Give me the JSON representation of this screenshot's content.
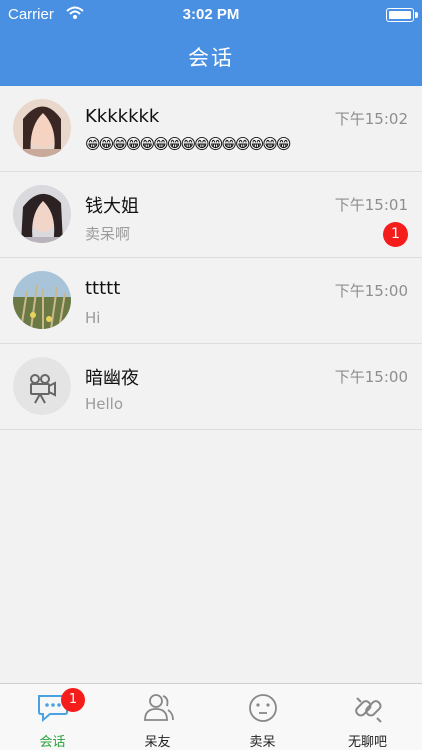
{
  "status_bar": {
    "carrier": "Carrier",
    "time": "3:02 PM"
  },
  "nav": {
    "title": "会话"
  },
  "conversations": [
    {
      "name": "Kkkkkkk",
      "time": "下午15:02",
      "preview": "😁😁😁😁😁😁😁😁😁😁😁😁😁😁😁",
      "unread": ""
    },
    {
      "name": "钱大姐",
      "time": "下午15:01",
      "preview": "卖呆啊",
      "unread": "1"
    },
    {
      "name": "ttttt",
      "time": "下午15:00",
      "preview": "Hi",
      "unread": ""
    },
    {
      "name": "暗幽夜",
      "time": "下午15:00",
      "preview": "Hello",
      "unread": ""
    }
  ],
  "tabbar": {
    "tabs": [
      {
        "label": "会话",
        "badge": "1",
        "icon": "chat-bubble-icon"
      },
      {
        "label": "呆友",
        "icon": "friends-icon"
      },
      {
        "label": "卖呆",
        "icon": "face-icon"
      },
      {
        "label": "无聊吧",
        "icon": "chain-link-icon"
      }
    ]
  },
  "colors": {
    "header": "#4a90e2",
    "active_tab": "#2aa33a",
    "badge": "#f51c1c"
  }
}
